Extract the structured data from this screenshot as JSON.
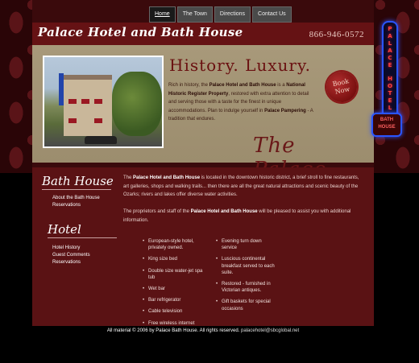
{
  "nav": {
    "tabs": [
      "Home",
      "The Town",
      "Directions",
      "Contact Us"
    ]
  },
  "header": {
    "logo": "Palace Hotel and Bath House",
    "phone": "866-946-0572"
  },
  "banner": {
    "headline": "History. Luxury.",
    "intro": {
      "p1": "Rich in history, the ",
      "b1": "Palace Hotel and Bath House",
      "p2": " is a ",
      "b2": "National Historic Register Property",
      "p3": ", restored with extra attention to detail and serving those with a taste for the finest in unique accommodations. Plan to indulge yourself in ",
      "b3": "Palace Pampering",
      "p4": " - A tradition that endures."
    },
    "book_now": {
      "line1": "Book",
      "line2": "Now"
    },
    "palace_text": "The Palace."
  },
  "sidebar": {
    "bath_house": {
      "heading": "Bath House",
      "links": [
        "About the Bath House",
        "Reservations"
      ]
    },
    "hotel": {
      "heading": "Hotel",
      "links": [
        "Hotel History",
        "Guest Comments",
        "Reservations"
      ]
    }
  },
  "main": {
    "para1": {
      "a": "The ",
      "b1": "Palace Hotel and Bath House",
      "c": " is located in the downtown historic district, a brief stroll to fine restaurants, art galleries, shops and walking trails... then there are all the great natural attractions and scenic beauty of the Ozarks; rivers and lakes offer diverse water activities."
    },
    "para2": {
      "a": "The proprietors and staff of the ",
      "b1": "Palace Hotel and Bath House",
      "c": " will be pleased to assist you with additional information."
    },
    "amenities_left": [
      "European-style hotel, privately owned.",
      "King size bed",
      "Double size water-jet spa tub",
      "Wet bar",
      "Bar refrigerator",
      "Cable television",
      "Free wireless internet"
    ],
    "amenities_right": [
      "Evening turn down service",
      "Luscious continental breakfast served to each suite.",
      "Restored - furnished in Victorian antiques.",
      "Gift baskets for special occasions"
    ]
  },
  "footer": {
    "copyright": "All material © 2006 by Palace Bath House. All rights reserved.",
    "email": "palacehotel@sbcglobal.net"
  },
  "neon": {
    "letters": [
      "P",
      "A",
      "L",
      "A",
      "C",
      "E",
      "",
      "H",
      "O",
      "T",
      "E",
      "L"
    ],
    "box_line1": "BATH",
    "box_line2": "HOUSE"
  },
  "colors": {
    "header": "#651214",
    "banner": "#a8997a",
    "content": "#5a1214",
    "neon_frame": "#2a55ff",
    "neon_text": "#ff4040"
  }
}
